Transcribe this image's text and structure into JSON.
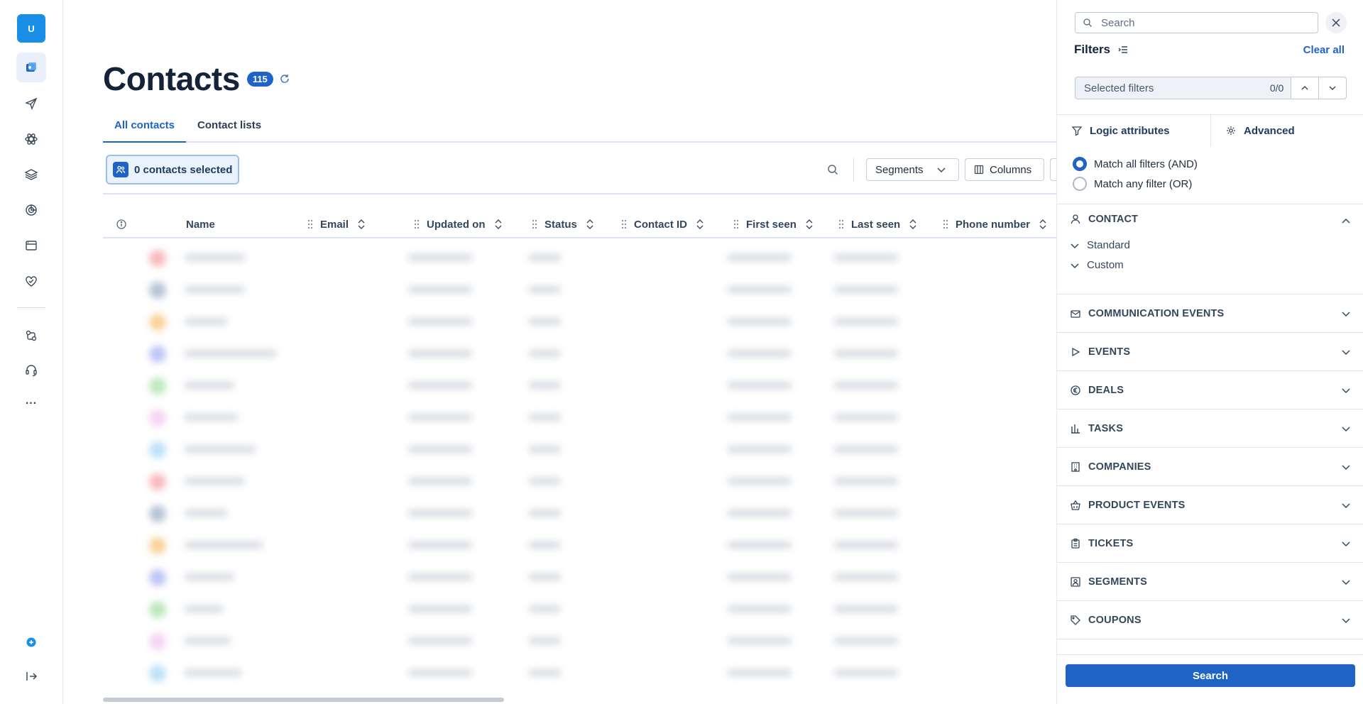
{
  "rail": {
    "avatar_letter": "U",
    "icons": [
      "contacts-icon",
      "send-icon",
      "automation-icon",
      "layers-icon",
      "target-icon",
      "browser-icon",
      "heart-badge-icon",
      "conversations-icon",
      "support-icon"
    ],
    "more": "...",
    "bottom_icons": [
      "plus-circle-icon",
      "logout-icon"
    ]
  },
  "page": {
    "title": "Contacts",
    "count": "115"
  },
  "tabs": [
    {
      "label": "All contacts",
      "active": true
    },
    {
      "label": "Contact lists",
      "active": false
    }
  ],
  "toolbar": {
    "selected_label": "0 contacts selected",
    "segments_label": "Segments",
    "columns_label": "Columns"
  },
  "table": {
    "columns": [
      "Name",
      "Email",
      "Updated on",
      "Status",
      "Contact ID",
      "First seen",
      "Last seen",
      "Phone number"
    ]
  },
  "filters": {
    "search_placeholder": "Search",
    "title": "Filters",
    "clear_all": "Clear all",
    "selected_filters_label": "Selected filters",
    "selected_filters_count": "0/0",
    "logic_attributes": "Logic attributes",
    "advanced": "Advanced",
    "match_all": "Match all filters (AND)",
    "match_any": "Match any filter (OR)",
    "contact_section": {
      "label": "CONTACT",
      "items": [
        "Standard",
        "Custom"
      ]
    },
    "sections": [
      {
        "label": "COMMUNICATION EVENTS",
        "icon": "mail-check-icon"
      },
      {
        "label": "EVENTS",
        "icon": "play-icon"
      },
      {
        "label": "DEALS",
        "icon": "currency-icon"
      },
      {
        "label": "TASKS",
        "icon": "bar-chart-icon"
      },
      {
        "label": "COMPANIES",
        "icon": "building-icon"
      },
      {
        "label": "PRODUCT EVENTS",
        "icon": "basket-icon"
      },
      {
        "label": "TICKETS",
        "icon": "clipboard-icon"
      },
      {
        "label": "SEGMENTS",
        "icon": "segment-icon"
      },
      {
        "label": "COUPONS",
        "icon": "tag-icon"
      }
    ],
    "search_button": "Search"
  },
  "colors": {
    "accent": "#1f63c7",
    "rail_avatar": "#1a8fe8"
  }
}
